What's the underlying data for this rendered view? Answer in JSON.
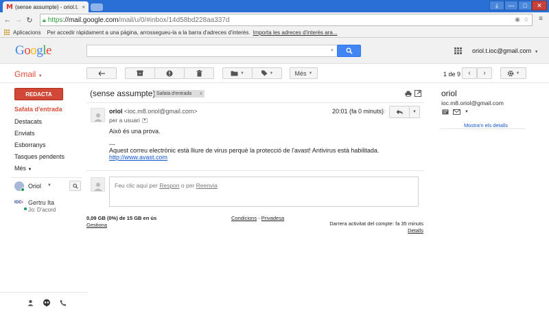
{
  "browser": {
    "tab_title": "(sense assumpte) - oriol.t.",
    "tab_icon": "gmail-icon",
    "tab_close": "×",
    "url_proto": "https",
    "url_host": "://mail.google.com",
    "url_path": "/mail/u/0/#inbox/14d58bd228aa337d",
    "bookmarks": {
      "apps_label": "Aplicacions",
      "hint": "Per accedir ràpidament a una pàgina, arrossegueu-la a la barra d'adreces d'interès.",
      "import_link": "Importa les adreces d'interès ara..."
    },
    "window_buttons": {
      "pin": "⤓",
      "minimize": "—",
      "maximize": "□",
      "close": "✕"
    }
  },
  "gmail": {
    "logo_letters": [
      "G",
      "o",
      "o",
      "g",
      "l",
      "e"
    ],
    "logo_colors": [
      "#4285f4",
      "#ea4335",
      "#fbbc05",
      "#4285f4",
      "#34a853",
      "#ea4335"
    ],
    "account": "oriol.t.ioc@gmail.com",
    "app_label": "Gmail",
    "toolbar": {
      "more_label": "Més",
      "pager": "1 de 9"
    },
    "nav": {
      "compose": "REDACTA",
      "items": [
        {
          "label": "Safata d'entrada",
          "active": true
        },
        {
          "label": "Destacats",
          "active": false
        },
        {
          "label": "Enviats",
          "active": false
        },
        {
          "label": "Esborranys",
          "active": false
        },
        {
          "label": "Tasques pendents",
          "active": false
        },
        {
          "label": "Més",
          "active": false
        }
      ]
    },
    "hangouts": {
      "me": "Oriol",
      "contact_name": "Gertru Ita",
      "contact_status": "Jo: D'acord"
    },
    "message": {
      "subject": "(sense assumpte)",
      "label_chip": "Safata d'entrada",
      "label_chip_close": "x",
      "sender_name": "oriol",
      "sender_email": "<ioc.m8.oriol@gmail.com>",
      "to_line": "per a usuari",
      "time": "20:01 (fa 0 minuts)",
      "body": "Això és una prova.",
      "signature_dash": "---",
      "avast_text": "Aquest correu electrònic està lliure de virus perquè la protecció de l'avast! Antivirus està habilitada.",
      "avast_link": "http://www.avast.com"
    },
    "reply": {
      "prefix": "Feu clic aquí per ",
      "respon": "Respon",
      "middle": " o per ",
      "reenvia": "Reenvia"
    },
    "footer": {
      "storage": "0,09 GB (0%) de 15 GB en ús",
      "manage": "Gestiona",
      "conditions": "Condicions",
      "separator": " - ",
      "privacy": "Privadesa",
      "last_activity": "Darrera activitat del compte: fa 35 minuts",
      "details": "Detalls"
    },
    "right_pane": {
      "name": "oriol",
      "email": "ioc.m8.oriol@gmail.com",
      "show_details": "Mostra'n els detalls"
    }
  }
}
